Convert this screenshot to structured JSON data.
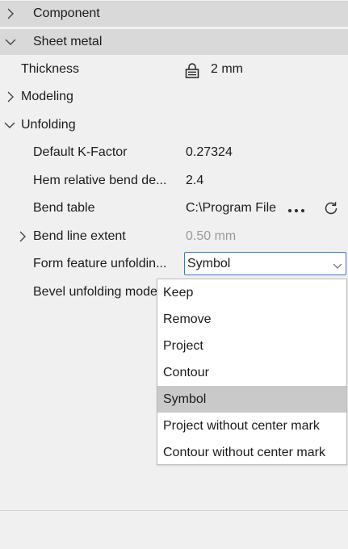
{
  "sections": {
    "component": {
      "label": "Component",
      "expanded": false
    },
    "sheet_metal": {
      "label": "Sheet metal",
      "expanded": true
    }
  },
  "properties": {
    "thickness": {
      "label": "Thickness",
      "value": "2 mm",
      "icon": "lock-icon"
    },
    "modeling": {
      "label": "Modeling",
      "expanded": false
    },
    "unfolding": {
      "label": "Unfolding",
      "expanded": true
    },
    "k_factor": {
      "label": "Default K-Factor",
      "value": "0.27324"
    },
    "hem": {
      "label": "Hem relative bend de...",
      "value": "2.4"
    },
    "bend_table": {
      "label": "Bend table",
      "value": "C:\\Program File",
      "more_icon": "more-icon",
      "refresh_icon": "refresh-icon"
    },
    "bend_line": {
      "label": "Bend line extent",
      "value": "0.50 mm",
      "expanded": false
    },
    "form_feature": {
      "label": "Form feature unfoldin...",
      "value": "Symbol",
      "arrow_icon": "chevron-down-icon"
    },
    "bevel": {
      "label": "Bevel unfolding mode"
    }
  },
  "dropdown": {
    "options": [
      "Keep",
      "Remove",
      "Project",
      "Contour",
      "Symbol",
      "Project without center mark",
      "Contour without center mark"
    ],
    "selected": "Symbol"
  },
  "colors": {
    "section_bg": "#d9d9d9",
    "panel_bg": "#f0f0f0",
    "focus_border": "#3b7bd4",
    "selected_option": "#c9c9c9",
    "muted_text": "#9a9a9a"
  }
}
